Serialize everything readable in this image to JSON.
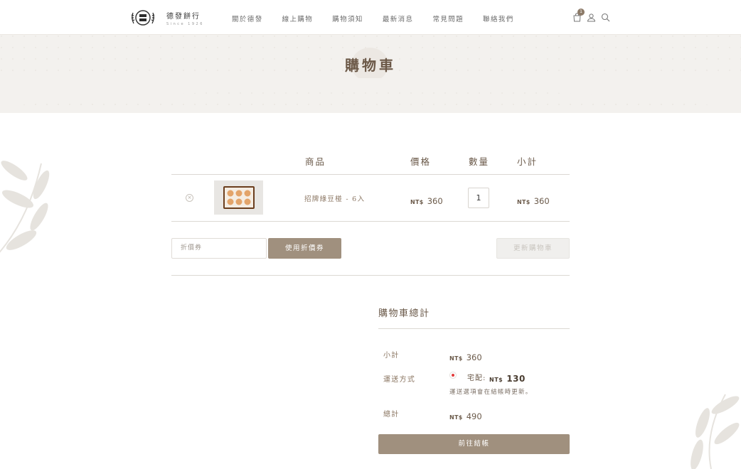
{
  "header": {
    "brand_name": "德發餅行",
    "brand_since": "Since 1926",
    "nav": [
      "關於德發",
      "線上購物",
      "購物須知",
      "最新消息",
      "常見問題",
      "聯絡我們"
    ],
    "cart_count": "1",
    "icons": [
      "bag-icon",
      "user-icon",
      "search-icon"
    ]
  },
  "banner": {
    "title": "購物車"
  },
  "cart": {
    "columns": {
      "product": "商品",
      "price": "價格",
      "quantity": "數量",
      "subtotal": "小計"
    },
    "items": [
      {
        "name": "招牌綠豆椪 - 6入",
        "price_currency": "NT$",
        "price": "360",
        "quantity": "1",
        "subtotal_currency": "NT$",
        "subtotal": "360"
      }
    ],
    "coupon_placeholder": "折價券",
    "apply_coupon_label": "使用折價券",
    "update_cart_label": "更新購物車"
  },
  "totals": {
    "title": "購物車總計",
    "subtotal_label": "小計",
    "subtotal_currency": "NT$",
    "subtotal_value": "360",
    "shipping_label": "運送方式",
    "shipping_option": "宅配:",
    "shipping_currency": "NT$",
    "shipping_value": "130",
    "shipping_note": "運送選項會在結帳時更新。",
    "total_label": "總計",
    "total_currency": "NT$",
    "total_value": "490",
    "checkout_label": "前往結帳"
  },
  "colors": {
    "accent": "#a0907e",
    "banner_bg": "#f3f1ee",
    "text": "#6b5a4a"
  }
}
